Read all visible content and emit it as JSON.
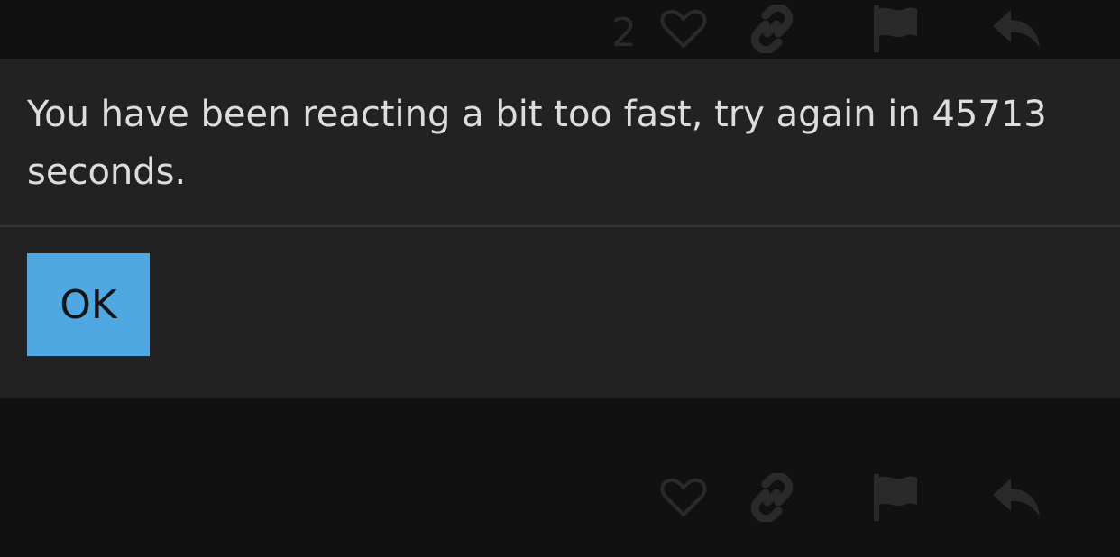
{
  "background": {
    "top_row": {
      "like_count": "2",
      "icons": [
        "heart-icon",
        "link-icon",
        "flag-icon",
        "reply-icon"
      ]
    },
    "bottom_row": {
      "icons": [
        "heart-icon",
        "link-icon",
        "flag-icon",
        "reply-icon"
      ]
    }
  },
  "dialog": {
    "message": "You have been reacting a bit too fast, try again in 45713 seconds.",
    "ok_label": "OK"
  },
  "colors": {
    "page_background": "#111111",
    "dialog_background": "#222222",
    "divider": "#363636",
    "message_text": "#dddddd",
    "primary_button": "#4fa8e2",
    "primary_button_text": "#141414",
    "dimmed_icon": "#2a2a2a"
  }
}
